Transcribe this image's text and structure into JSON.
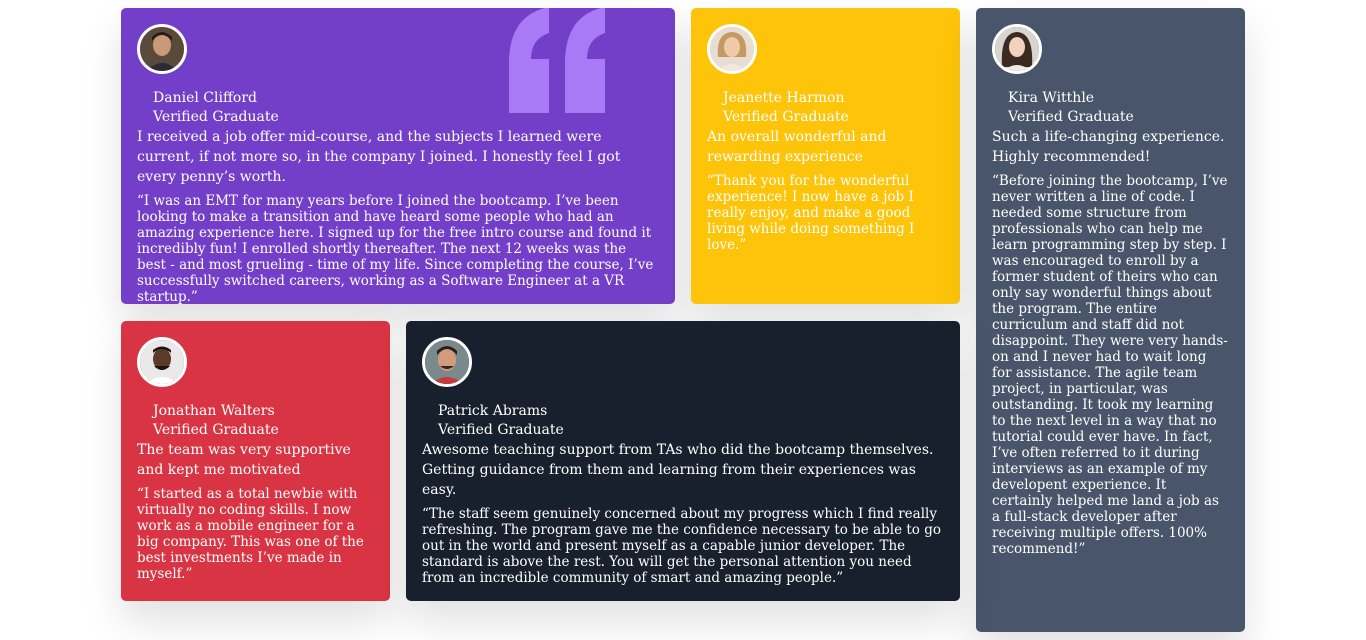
{
  "colors": {
    "purple": "#733fc8",
    "yellow": "#fdc40a",
    "slate": "#48556a",
    "red": "#d93444",
    "dark": "#19202d"
  },
  "testimonials": [
    {
      "name": "Daniel Clifford",
      "role": "Verified Graduate",
      "headline": "I received a job offer mid-course, and the subjects I learned were current, if not more so, in the company I joined. I honestly feel I got every penny’s worth.",
      "quote": "“I was an EMT for many years before I joined the bootcamp. I’ve been looking to make a transition and have heard some people who had an amazing experience here. I signed up for the free intro course and found it incredibly fun! I enrolled shortly thereafter. The next 12 weeks was the best - and most grueling - time of my life. Since completing the course, I’ve successfully switched careers, working as a Software Engineer at a VR startup.”"
    },
    {
      "name": "Jeanette Harmon",
      "role": "Verified Graduate",
      "headline": "An overall wonderful and rewarding experience",
      "quote": "“Thank you for the wonderful experience! I now have a job I really enjoy, and make a good living while doing something I love.”"
    },
    {
      "name": "Kira Witthle",
      "role": "Verified Graduate",
      "headline": "Such a life-changing experience. Highly recommended!",
      "quote": "“Before joining the bootcamp, I’ve never written a line of code. I needed some structure from professionals who can help me learn programming step by step. I was encouraged to enroll by a former student of theirs who can only say wonderful things about the program. The entire curriculum and staff did not disappoint. They were very hands-on and I never had to wait long for assistance. The agile team project, in particular, was outstanding. It took my learning to the next level in a way that no tutorial could ever have. In fact, I’ve often referred to it during interviews as an example of my developent experience. It certainly helped me land a job as a full-stack developer after receiving multiple offers. 100% recommend!”"
    },
    {
      "name": "Jonathan Walters",
      "role": "Verified Graduate",
      "headline": "The team was very supportive and kept me motivated",
      "quote": "“I started as a total newbie with virtually no coding skills. I now work as a mobile engineer for a big company. This was one of the best investments I’ve made in myself.”"
    },
    {
      "name": "Patrick Abrams",
      "role": "Verified Graduate",
      "headline": "Awesome teaching support from TAs who did the bootcamp themselves. Getting guidance from them and learning from their experiences was easy.",
      "quote": "“The staff seem genuinely concerned about my progress which I find really refreshing. The program gave me the confidence necessary to be able to go out in the world and present myself as a capable junior developer. The standard is above the rest. You will get the personal attention you need from an incredible community of smart and amazing people.”"
    }
  ]
}
